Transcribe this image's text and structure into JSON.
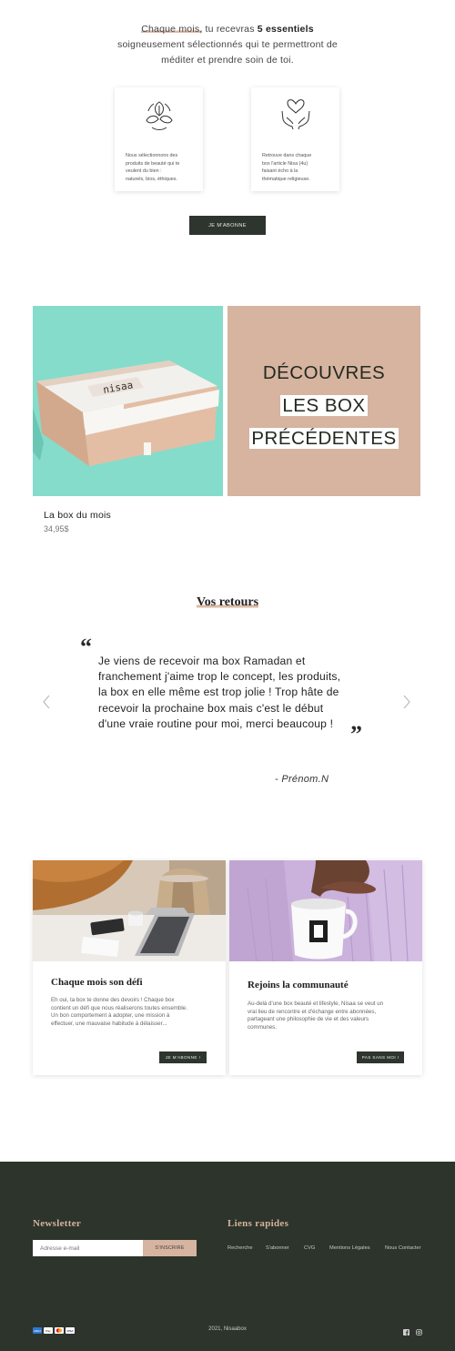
{
  "intro": {
    "line1_highlight": "Chaque mois,",
    "line1_mid": " tu recevras ",
    "line1_bold": "5 essentiels",
    "line2": "soigneusement sélectionnés qui te permettront de",
    "line3": "méditer et prendre soin de toi."
  },
  "cards": [
    {
      "icon": "leaves-cycle-icon",
      "lines": [
        "Nous sélectionnons des",
        "produits de beauté qui te",
        "veulent du bien :",
        "naturels, bios, éthiques."
      ]
    },
    {
      "icon": "hands-heart-icon",
      "lines": [
        "Retrouve dans chaque",
        "box l'article Nisa (4u)",
        "faisant écho à la",
        "thématique religieuse."
      ]
    }
  ],
  "subscribe_button": "JE M'ABONNE",
  "hero": {
    "box_brand": "nisaa",
    "title_lines": [
      "DÉCOUVRES",
      "LES BOX",
      "PRÉCÉDENTES"
    ],
    "bg_color": "#d6b4a0",
    "teal_color": "#85dccb"
  },
  "product": {
    "name": "La box du mois",
    "price": "34,95$"
  },
  "reviews": {
    "title": "Vos retours",
    "quote_lines": [
      "Je viens de recevoir ma box Ramadan et",
      "franchement j'aime trop le concept, les produits,",
      "la box en elle même est trop jolie ! Trop hâte de",
      "recevoir la prochaine box mais c'est le début",
      "d'une vraie routine pour moi, merci beaucoup !"
    ],
    "author": "- Prénom.N",
    "prev_arrow": "chevron-left-icon",
    "next_arrow": "chevron-right-icon"
  },
  "features": [
    {
      "title": "Chaque mois son défi",
      "lines": [
        "Eh oui, ta box te donne des devoirs ! Chaque box",
        "contient un défi que nous réaliserons toutes ensemble.",
        "Un bon comportement à adopter, une mission à",
        "effectuer, une mauvaise habitude à délaisser..."
      ],
      "button": "JE M'ABONNE !"
    },
    {
      "title": "Rejoins la communauté",
      "lines": [
        "Au-delà d'une box beauté et lifestyle, Nisaa se veut un",
        "vrai lieu de rencontre et d'échange entre abonnées,",
        "partageant une philosophie de vie et des valeurs",
        "communes."
      ],
      "button": "PAS SANS MOI !"
    }
  ],
  "footer": {
    "newsletter_title": "Newsletter",
    "email_placeholder": "Adresse e-mail",
    "signup_button": "S'INSCRIRE",
    "links_title": "Liens rapides",
    "links": [
      "Recherche",
      "S'abonner",
      "CVG",
      "Mentions Légales",
      "Nous Contacter"
    ],
    "copyright": "2021, Nisaabox",
    "payment_icons": [
      "amex-icon",
      "applepay-icon",
      "mastercard-icon",
      "visa-icon"
    ],
    "payment_labels": [
      "AMEX",
      "Pay",
      "",
      "VISA"
    ],
    "social_icons": [
      "facebook-icon",
      "instagram-icon"
    ],
    "bg_color": "#2d342b",
    "accent_color": "#d5b39d"
  }
}
